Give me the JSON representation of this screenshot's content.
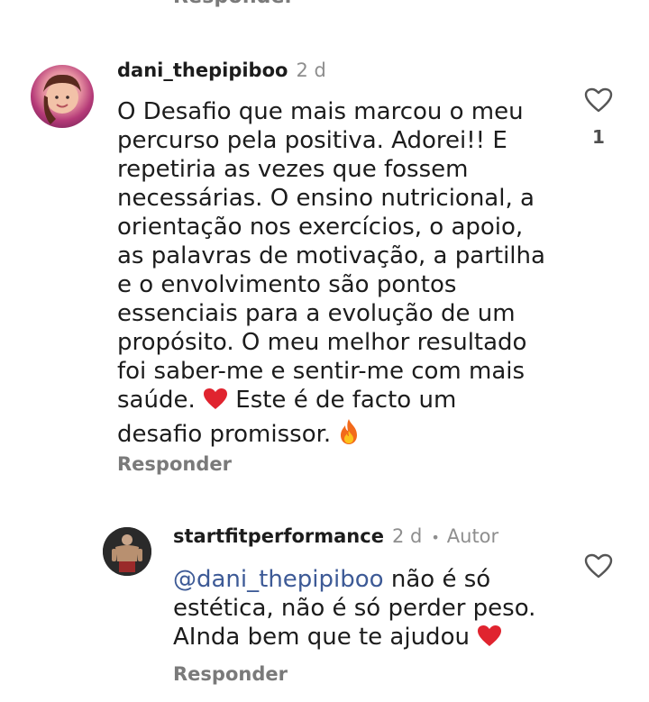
{
  "top": {
    "reply_label": "Responder"
  },
  "comment": {
    "username": "dani_thepipiboo",
    "time": "2 d",
    "lines": [
      "O Desafio que mais marcou o meu",
      "percurso pela positiva. Adorei!! E",
      "repetiria as vezes que fossem",
      "necessárias. O ensino nutricional, a",
      "orientação nos exercícios, o apoio,",
      "as palavras de motivação, a partilha",
      "e o envolvimento são pontos",
      "essenciais para a evolução de um",
      "propósito. O meu melhor resultado",
      "foi saber-me e sentir-me com mais",
      "saúde.",
      "Este é de facto um",
      "desafio promissor."
    ],
    "like_count": "1",
    "reply_label": "Responder",
    "icons": [
      "heart-outline-icon",
      "red-heart-emoji",
      "fire-emoji"
    ]
  },
  "reply": {
    "username": "startfitperformance",
    "time": "2 d",
    "separator": "•",
    "author_label": "Autor",
    "mention": "@dani_thepipiboo",
    "lines": [
      "não é só",
      "estética, não é só perder peso.",
      "AInda bem que te ajudou"
    ],
    "reply_label": "Responder",
    "icons": [
      "heart-outline-icon",
      "red-heart-emoji"
    ]
  },
  "colors": {
    "text": "#1c1c1c",
    "secondary": "#8e8e8e",
    "mention": "#3d5a96",
    "heart_emoji": "#e0242f"
  }
}
